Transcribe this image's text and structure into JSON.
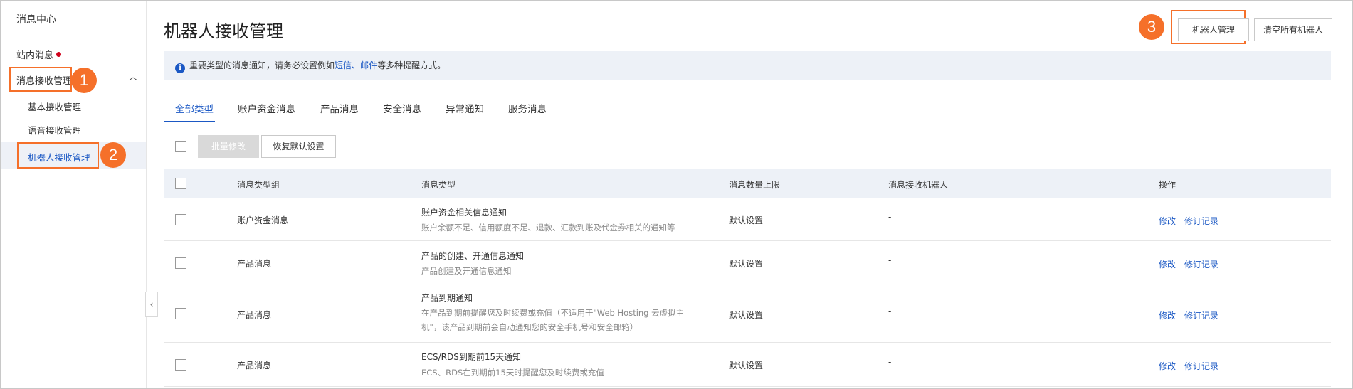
{
  "sidebar": {
    "title": "消息中心",
    "inbox_label": "站内消息",
    "manage_label": "消息接收管理",
    "sub_items": [
      "基本接收管理",
      "语音接收管理",
      "机器人接收管理"
    ],
    "annotations": [
      "1",
      "2"
    ]
  },
  "header": {
    "title": "机器人接收管理",
    "robot_manage_btn": "机器人管理",
    "clear_robots_btn": "清空所有机器人",
    "annotation": "3"
  },
  "notice": {
    "text_before": "重要类型的消息通知，请务必设置例如",
    "sms_link": "短信",
    "separator": "、",
    "mail_link": "邮件",
    "text_after": "等多种提醒方式。"
  },
  "tabs": [
    "全部类型",
    "账户资金消息",
    "产品消息",
    "安全消息",
    "异常通知",
    "服务消息"
  ],
  "toolbar": {
    "batch_edit": "批量修改",
    "restore_default": "恢复默认设置"
  },
  "table": {
    "columns": [
      "消息类型组",
      "消息类型",
      "消息数量上限",
      "消息接收机器人",
      "操作"
    ],
    "rows": [
      {
        "group": "账户资金消息",
        "type_title": "账户资金相关信息通知",
        "type_desc": [
          "账户余额不足、信用额度不足、退款、汇款到账及代金券相关的通知等"
        ],
        "limit": "默认设置",
        "robot": "-",
        "edit": "修改",
        "history": "修订记录"
      },
      {
        "group": "产品消息",
        "type_title": "产品的创建、开通信息通知",
        "type_desc": [
          "产品创建及开通信息通知"
        ],
        "limit": "默认设置",
        "robot": "-",
        "edit": "修改",
        "history": "修订记录"
      },
      {
        "group": "产品消息",
        "type_title": "产品到期通知",
        "type_desc": [
          "在产品到期前提醒您及时续费或充值（不适用于\"Web Hosting 云虚拟主",
          "机\"，该产品到期前会自动通知您的安全手机号和安全邮箱）"
        ],
        "limit": "默认设置",
        "robot": "-",
        "edit": "修改",
        "history": "修订记录"
      },
      {
        "group": "产品消息",
        "type_title": "ECS/RDS到期前15天通知",
        "type_desc": [
          "ECS、RDS在到期前15天时提醒您及时续费或充值"
        ],
        "limit": "默认设置",
        "robot": "-",
        "edit": "修改",
        "history": "修订记录"
      }
    ]
  },
  "colors": {
    "accent": "#1b58c4",
    "highlight": "#f5702a",
    "header_bg": "#edf1f7",
    "alert_dot": "#d0021b"
  },
  "icons": [
    "info-icon",
    "chevron-up-icon",
    "chevron-left-icon",
    "red-dot-icon"
  ]
}
